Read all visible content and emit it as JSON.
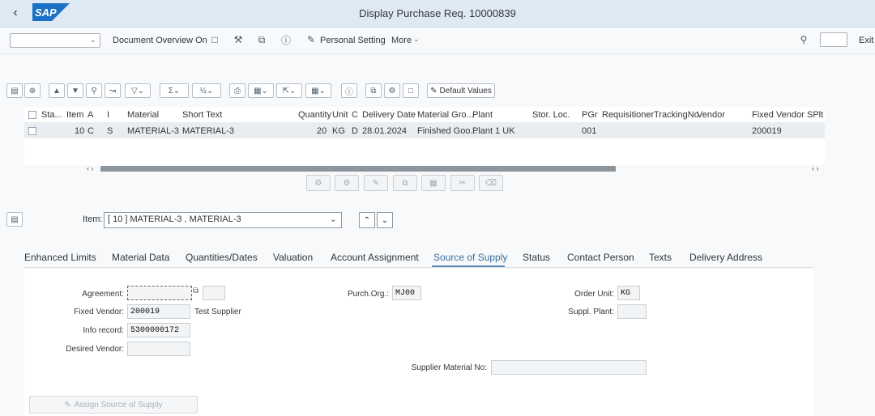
{
  "shell": {
    "title": "Display Purchase Req. 10000839",
    "back_icon": "back-icon",
    "logo_text": "SAP",
    "logo_color": "#1b71c5"
  },
  "toolbar": {
    "doc_overview": "Document Overview On",
    "personal_setting": "Personal Setting",
    "more": "More",
    "exit": "Exit"
  },
  "alv_toolbar": {
    "default_values": "Default Values"
  },
  "table": {
    "headers": [
      "Sta...",
      "Item",
      "A",
      "I",
      "Material",
      "Short Text",
      "Quantity",
      "Unit",
      "C",
      "Delivery Date",
      "Material Gro...",
      "Plant",
      "Stor. Loc.",
      "PGr",
      "Requisitioner",
      "TrackingNo",
      "Vendor",
      "Fixed Vendor",
      "SPlt"
    ],
    "row": {
      "item": "10",
      "a": "C",
      "i": "S",
      "material": "MATERIAL-3",
      "short_text": "MATERIAL-3",
      "quantity": "20",
      "unit": "KG",
      "c": "D",
      "delivery_date": "28.01.2024",
      "material_group": "Finished Goo...",
      "plant": "Plant 1 UK",
      "pgr": "001",
      "fixed_vendor": "200019"
    }
  },
  "item_selector": {
    "label": "Item:",
    "value": "[ 10 ] MATERIAL-3 , MATERIAL-3"
  },
  "tabs": [
    "Enhanced Limits",
    "Material Data",
    "Quantities/Dates",
    "Valuation",
    "Account Assignment",
    "Source of Supply",
    "Status",
    "Contact Person",
    "Texts",
    "Delivery Address"
  ],
  "active_tab": "Source of Supply",
  "form": {
    "agreement_label": "Agreement:",
    "agreement_value": "",
    "fixed_vendor_label": "Fixed Vendor:",
    "fixed_vendor_value": "200019",
    "fixed_vendor_name": "Test Supplier",
    "info_record_label": "Info record:",
    "info_record_value": "5300000172",
    "desired_vendor_label": "Desired Vendor:",
    "desired_vendor_value": "",
    "purch_org_label": "Purch.Org.:",
    "purch_org_value": "MJ00",
    "order_unit_label": "Order Unit:",
    "order_unit_value": "KG",
    "suppl_plant_label": "Suppl. Plant:",
    "suppl_plant_value": "",
    "supplier_material_label": "Supplier Material No:",
    "supplier_material_value": "",
    "assign_button": "Assign Source of Supply"
  }
}
